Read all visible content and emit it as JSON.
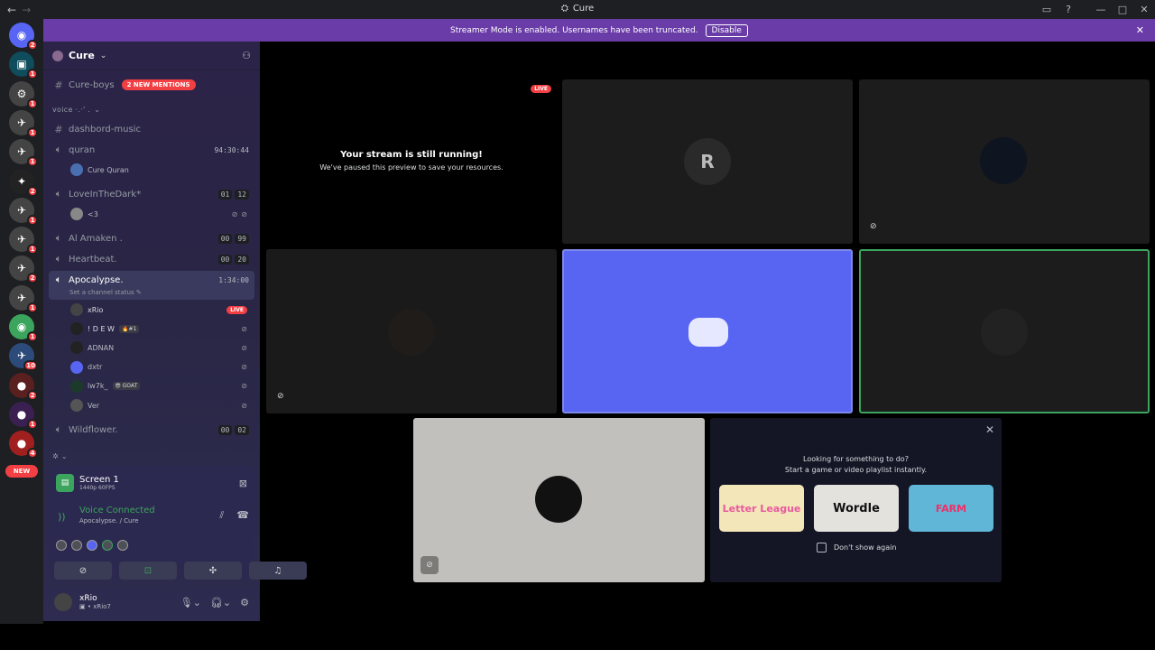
{
  "window": {
    "title": "Cure",
    "back": "←",
    "forward": "→",
    "controls": {
      "inbox": "▭",
      "help": "?",
      "minimize": "—",
      "maximize": "□",
      "close": "✕"
    }
  },
  "guilds": [
    {
      "badge": "2",
      "color": "#5865f2",
      "glyph": "◉"
    },
    {
      "badge": "1",
      "color": "#0f4c5c",
      "glyph": "▣"
    },
    {
      "badge": "1",
      "color": "#444",
      "glyph": "⚙"
    },
    {
      "badge": "1",
      "color": "#444",
      "glyph": "✈"
    },
    {
      "badge": "1",
      "color": "#444",
      "glyph": "✈"
    },
    {
      "badge": "2",
      "color": "#222",
      "glyph": "✦"
    },
    {
      "badge": "1",
      "color": "#444",
      "glyph": "✈"
    },
    {
      "badge": "1",
      "color": "#444",
      "glyph": "✈"
    },
    {
      "badge": "2",
      "color": "#444",
      "glyph": "✈"
    },
    {
      "badge": "1",
      "color": "#444",
      "glyph": "✈"
    },
    {
      "badge": "1",
      "color": "#3ba55d",
      "glyph": "◉"
    },
    {
      "badge": "10",
      "color": "#2c4b7a",
      "glyph": "✈"
    },
    {
      "badge": "2",
      "color": "#5a2020",
      "glyph": "●"
    },
    {
      "badge": "1",
      "color": "#3a2050",
      "glyph": "●"
    },
    {
      "badge": "4",
      "color": "#a02020",
      "glyph": "●"
    }
  ],
  "guild_new": "NEW",
  "banner": {
    "text": "Streamer Mode is enabled. Usernames have been truncated.",
    "button": "Disable",
    "close": "✕"
  },
  "server": {
    "name": "Cure",
    "chevron": "⌄",
    "add_user": "⚇"
  },
  "channels": {
    "cure_boys": "Cure-boys",
    "mentions": "2 NEW MENTIONS",
    "category": "voice ·.·' .",
    "category_chevron": "⌄",
    "dashboard": "dashbord-music",
    "quran": "quran",
    "quran_time": "94:30:44",
    "quran_user": "Cure Quran",
    "love": "LoveInTheDark*",
    "love_a": "01",
    "love_b": "12",
    "love_user": "<3",
    "amaken": "Al Amaken .",
    "amaken_a": "00",
    "amaken_b": "99",
    "heartbeat": "Heartbeat.",
    "heartbeat_a": "00",
    "heartbeat_b": "20",
    "apoc": "Apocalypse.",
    "apoc_time": "1:34:00",
    "apoc_status": "Set a channel status ✎",
    "wild": "Wildflower.",
    "wild_a": "00",
    "wild_b": "02",
    "bottom_cat": "✲ ⌄"
  },
  "voice_users": [
    {
      "name": "xRio",
      "extra": "LIVE"
    },
    {
      "name": "! D E W",
      "tag": "🔥#1"
    },
    {
      "name": "ADNAN"
    },
    {
      "name": "dxtr"
    },
    {
      "name": "lw7k_",
      "tag": "😎 GOAT"
    },
    {
      "name": "Ver"
    }
  ],
  "screen": {
    "title": "Screen 1",
    "sub": "1440p 60FPS"
  },
  "voice": {
    "title": "Voice Connected",
    "sub": "Apocalypse. / Cure"
  },
  "user": {
    "name": "xRio",
    "status": "xRio7"
  },
  "stage": {
    "live": "LIVE",
    "heading": "Your stream is still running!",
    "sub": "We've paused this preview to save your resources."
  },
  "activity": {
    "line1": "Looking for something to do?",
    "line2": "Start a game or video playlist instantly.",
    "cards": [
      "Letter League",
      "Wordle",
      "FARM"
    ],
    "checkbox": "Don't show again",
    "close": "✕"
  }
}
